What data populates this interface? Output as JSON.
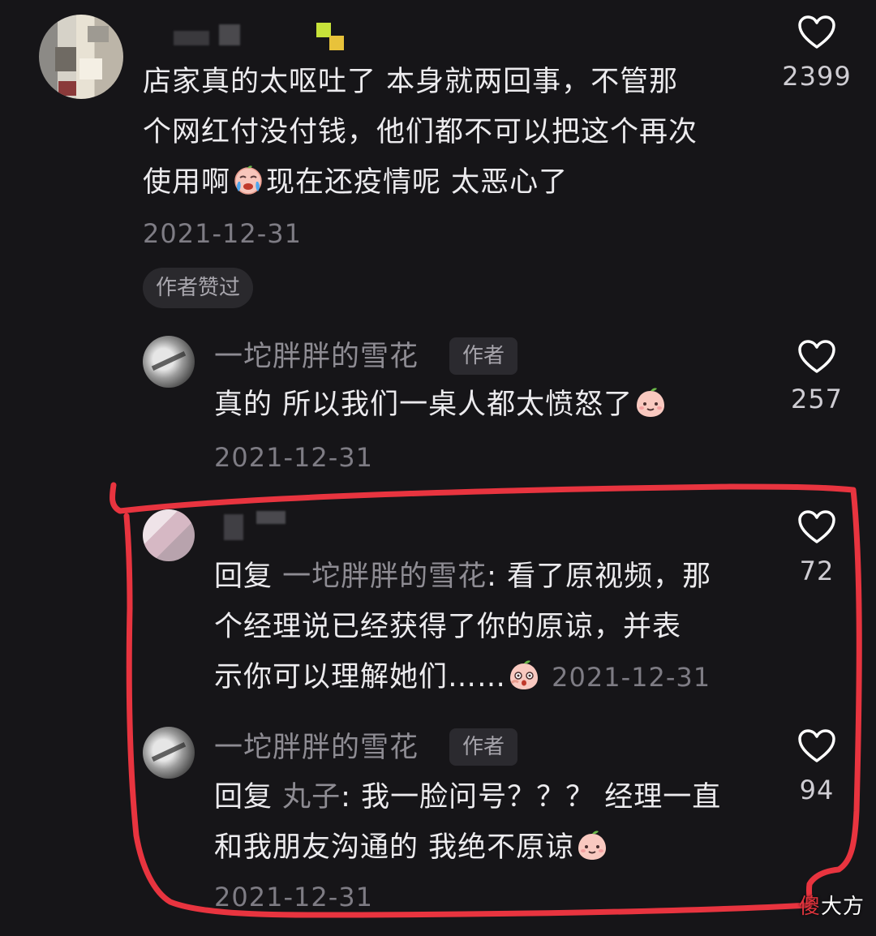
{
  "comments": [
    {
      "text_parts": [
        "店家真的太呕吐了 本身就两回事，不管那",
        "个网红付没付钱，他们都不可以把这个再次",
        "使用啊",
        "现在还疫情呢 太恶心了"
      ],
      "emoji": "crying-face",
      "date": "2021-12-31",
      "liked_by_author": "作者赞过",
      "likes": "2399"
    },
    {
      "username": "一坨胖胖的雪花",
      "author_tag": "作者",
      "text": "真的 所以我们一桌人都太愤怒了",
      "emoji": "peach-smile",
      "date": "2021-12-31",
      "likes": "257"
    },
    {
      "reply_prefix": "回复",
      "reply_target": "一坨胖胖的雪花",
      "text_line1": ": 看了原视频，那",
      "text_line2": "个经理说已经获得了你的原谅，并表",
      "text_line3": "示你可以理解她们……",
      "emoji": "peach-shocked",
      "date": "2021-12-31",
      "likes": "72"
    },
    {
      "username": "一坨胖胖的雪花",
      "author_tag": "作者",
      "reply_prefix": "回复",
      "reply_target": "丸子",
      "text_line1": ": 我一脸问号？？？ 经理一直",
      "text_line2": "和我朋友沟通的 我绝不原谅",
      "emoji": "peach-smile",
      "date": "2021-12-31",
      "likes": "94"
    }
  ],
  "watermark": {
    "first": "傻",
    "rest": "大方"
  },
  "colors": {
    "background": "#161518",
    "highlight": "#e8343f"
  }
}
